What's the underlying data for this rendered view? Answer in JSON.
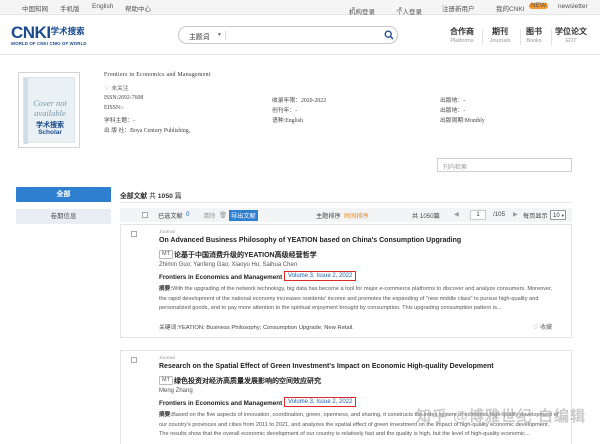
{
  "topbar": {
    "links": [
      "中国知网",
      "手机版",
      "English",
      "帮助中心"
    ],
    "login_org": "机构登录",
    "login_user": "个人登录",
    "register": "注册新用户",
    "mycnki": "我的CNKI",
    "mycnki_badge": "NEW",
    "newsletter": "newsletter"
  },
  "logo": {
    "big": "CNKI",
    "zh": "学术搜索",
    "scholar": "Scholar",
    "sub": "WORLD OF CNKI CNKI OF WORLD"
  },
  "search": {
    "scope": "主题词",
    "placeholder": ""
  },
  "nav": [
    {
      "zh": "合作商",
      "en": "Platforms"
    },
    {
      "zh": "期刊",
      "en": "Journals"
    },
    {
      "zh": "图书",
      "en": "Books"
    },
    {
      "zh": "学位论文",
      "en": "EDT"
    }
  ],
  "journal": {
    "cover_text": "Cover not available",
    "cover_logo": "学术搜索",
    "cover_logo_sub": "Scholar",
    "title": "Frontiers in Economics and Management",
    "follow": "未关注",
    "issn": "ISSN:2692-7608",
    "eissn": "EISSN:-",
    "subject": "学科主题：-",
    "publisher": "出 版 社：Boya Century Publishing,",
    "coverage": "收录年限：2020-2022",
    "founded": "创刊年：-",
    "language": "语种:English",
    "place": "出版地：-",
    "area": "出版地：-",
    "frequency": "出版周期:Monthly",
    "inner_search": "刊内检索"
  },
  "tabs": {
    "all": "全部",
    "volumes": "卷期信息"
  },
  "list": {
    "all_label": "全部文献",
    "total_prefix": "共",
    "total": "1050",
    "total_suffix": "篇",
    "selected": "已选文献",
    "selected_count": "0",
    "clear": "清除",
    "export": "导出文献",
    "sort_topic": "主题排序",
    "sort_time": "时间排序",
    "count": "共 1050篇",
    "page": "1",
    "pages": "/105",
    "per_page_label": "每页显示",
    "per_page": "10"
  },
  "articles": [
    {
      "type": "Journal",
      "title": "On Advanced Business Philosophy of YEATION based on China's Consumption Upgrading",
      "mt": "MT",
      "cn_title": "论基于中国消费升级的YEATION高级经营哲学",
      "authors": "Zhimin Guo; Yanfeng Gao; Xiaoyu Hu; Saihua Chen",
      "source": "Frontiers in Economics and Management",
      "volume": "Volume 3, Issue 2, 2022",
      "abstract_label": "摘要:",
      "abstract": "With the upgrading of the network technology, big data has become a tool for major e-commerce platforms to discover and analyze consumers. Moreover, the rapid development of the national economy increases residents' income and promotes the expanding of \"new middle class\" to pursue high-quality and personalized goods, and to pay more attention to the spiritual enjoyment brought by consumption. This upgrading consumption pattern is...",
      "keywords_label": "关键词:",
      "keywords": "YEATION; Business Philosophy; Consumption Upgrade; New Retail.",
      "fav": "收藏"
    },
    {
      "type": "Journal",
      "title": "Research on the Spatial Effect of Green Investment's Impact on Economic High-quality Development",
      "mt": "MT",
      "cn_title": "绿色投资对经济高质量发展影响的空间效应研究",
      "authors": "Meng Zhang",
      "source": "Frontiers in Economics and Management",
      "volume": "Volume 3, Issue 2, 2022",
      "abstract_label": "摘要:",
      "abstract": "Based on the five aspects of innovation, coordination, green, openness, and sharing, it constructs the index system of economic high-quality development of our country's provinces and cities from 2011 to 2021, and analyzes the spatial effect of green investment on the impact of high-quality economic development. The results show that the overall economic development of our country is relatively fast and the quality is high, but the level of high-quality economic...",
      "keywords_label": "",
      "keywords": "",
      "fav": ""
    }
  ],
  "watermark": "知乎 @博雅世纪 白编辑",
  "colors": {
    "brand": "#1c4b8f",
    "accent": "#2f7fd1",
    "highlight_border": "#d92a2a",
    "link": "#1a5fb4"
  }
}
